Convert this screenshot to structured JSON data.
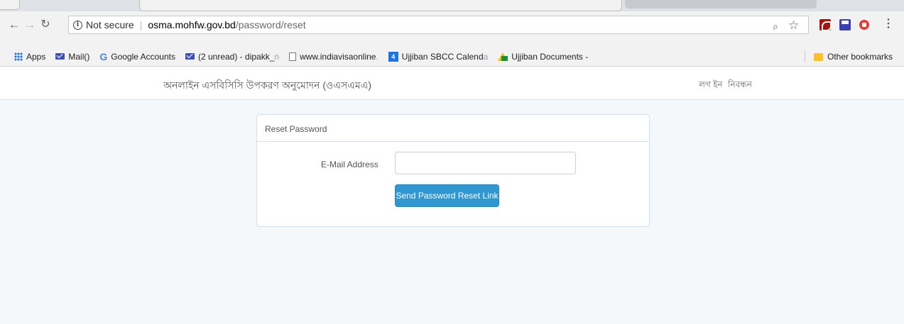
{
  "browser": {
    "security_label": "Not secure",
    "url_host": "osma.mohfw.gov.bd",
    "url_path": "/password/reset",
    "icons": [
      "back-arrow-icon",
      "forward-arrow-icon",
      "reload-icon",
      "info-icon",
      "zoom-icon",
      "star-icon",
      "pdf-extension-icon",
      "save-extension-icon",
      "adblock-extension-icon",
      "menu-icon"
    ]
  },
  "bookmarks": {
    "items": [
      {
        "label": "Apps",
        "fade": ""
      },
      {
        "label": "Mail()",
        "fade": ""
      },
      {
        "label": "Google Accounts",
        "fade": ""
      },
      {
        "label": "(2 unread) - dipakk_",
        "fade": "n"
      },
      {
        "label": "www.indiavisaonline",
        "fade": "."
      },
      {
        "label": "Ujjiban SBCC Calend",
        "fade": "a"
      },
      {
        "label": "Ujjiban Documents -",
        "fade": ""
      }
    ],
    "other_label": "Other bookmarks"
  },
  "navbar": {
    "brand": "অনলাইন এসবিসিসি উপকরণ অনুমোদন (ওএসএমএ)",
    "login": "লগ ইন",
    "register": "নিবন্ধন"
  },
  "panel": {
    "heading": "Reset Password",
    "email_label": "E-Mail Address",
    "email_value": "",
    "submit_label": "Send Password Reset Link"
  },
  "colors": {
    "primary_button": "#3097d1",
    "page_background": "#f5f8fa",
    "panel_border": "#d3e0e9"
  }
}
